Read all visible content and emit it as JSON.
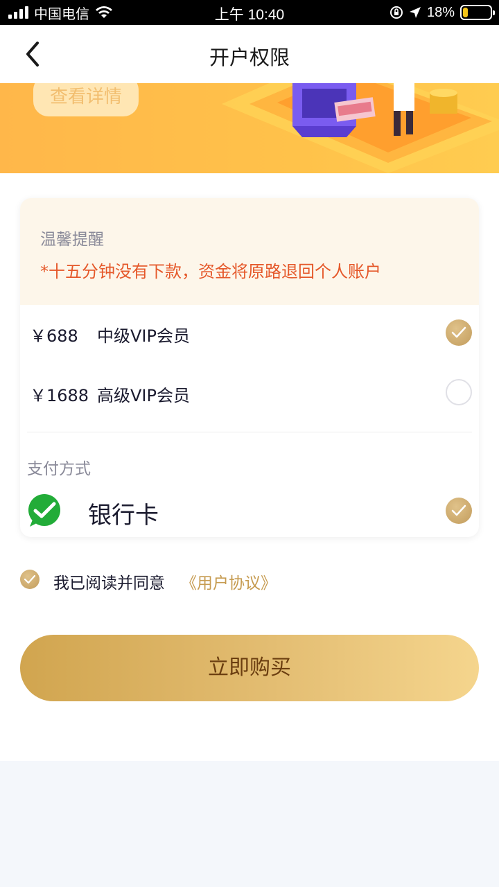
{
  "status_bar": {
    "carrier": "中国电信",
    "time": "上午 10:40",
    "battery": "18%",
    "battery_level": 0.18
  },
  "nav": {
    "title": "开户权限"
  },
  "banner": {
    "button_label": "查看详情"
  },
  "notice": {
    "title": "温馨提醒",
    "text": "*十五分钟没有下款，资金将原路退回个人账户"
  },
  "plans": [
    {
      "price": "￥688",
      "name": "中级VIP会员",
      "selected": true
    },
    {
      "price": "￥1688",
      "name": "高级VIP会员",
      "selected": false
    }
  ],
  "payment": {
    "label": "支付方式",
    "method": "银行卡",
    "selected": true
  },
  "agreement": {
    "text": "我已阅读并同意",
    "link": "《用户协议》",
    "checked": true
  },
  "buy_button": {
    "label": "立即购买"
  },
  "colors": {
    "accent_gold": "#c69b50",
    "warning": "#e5582a",
    "banner": "#ffc24a"
  }
}
